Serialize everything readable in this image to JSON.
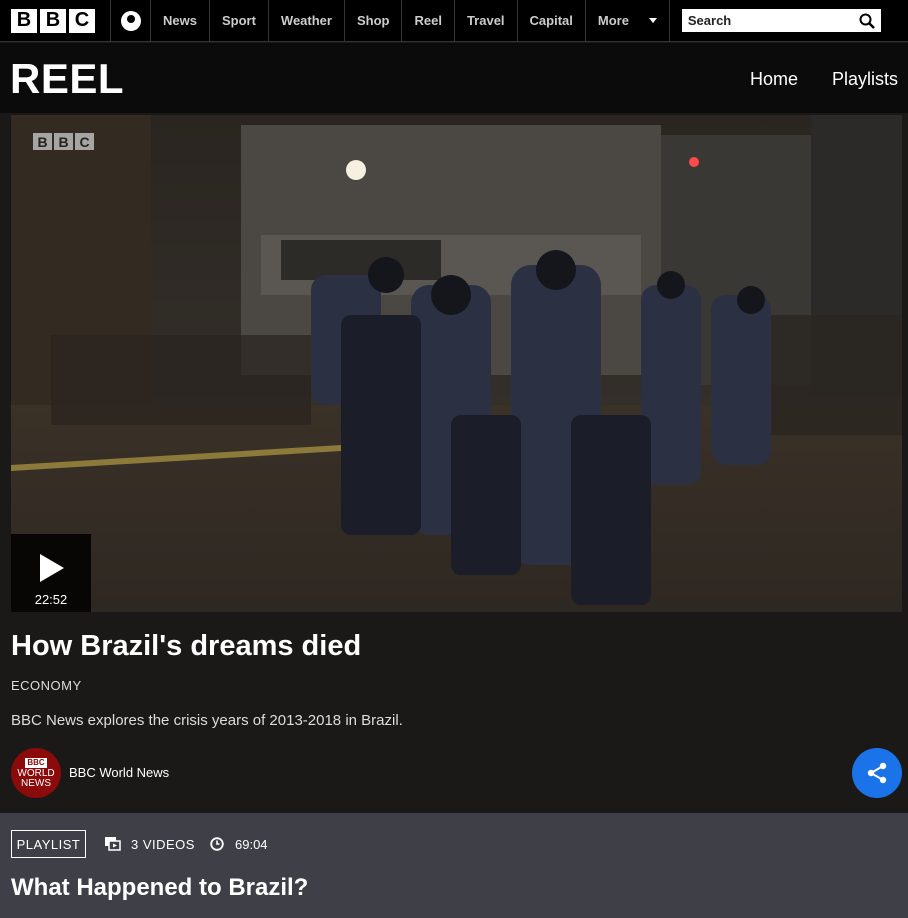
{
  "topnav": {
    "logo": [
      "B",
      "B",
      "C"
    ],
    "items": [
      "News",
      "Sport",
      "Weather",
      "Shop",
      "Reel",
      "Travel",
      "Capital"
    ],
    "more_label": "More",
    "search_label": "Search"
  },
  "reel": {
    "title": "REEL",
    "nav": [
      "Home",
      "Playlists"
    ]
  },
  "video": {
    "watermark": [
      "B",
      "B",
      "C"
    ],
    "duration": "22:52"
  },
  "article": {
    "headline": "How Brazil's dreams died",
    "category": "ECONOMY",
    "description": "BBC News explores the crisis years of 2013-2018 in Brazil.",
    "source_logo_top": "BBC",
    "source_logo_lines": [
      "WORLD",
      "NEWS"
    ],
    "source_name": "BBC World News"
  },
  "playlist": {
    "badge": "PLAYLIST",
    "videos_count": "3 VIDEOS",
    "duration": "69:04",
    "title": "What Happened to Brazil?"
  },
  "colors": {
    "share": "#1a73e8",
    "playlist_bg": "#3f4047",
    "source_logo": "#8b0a0a"
  }
}
